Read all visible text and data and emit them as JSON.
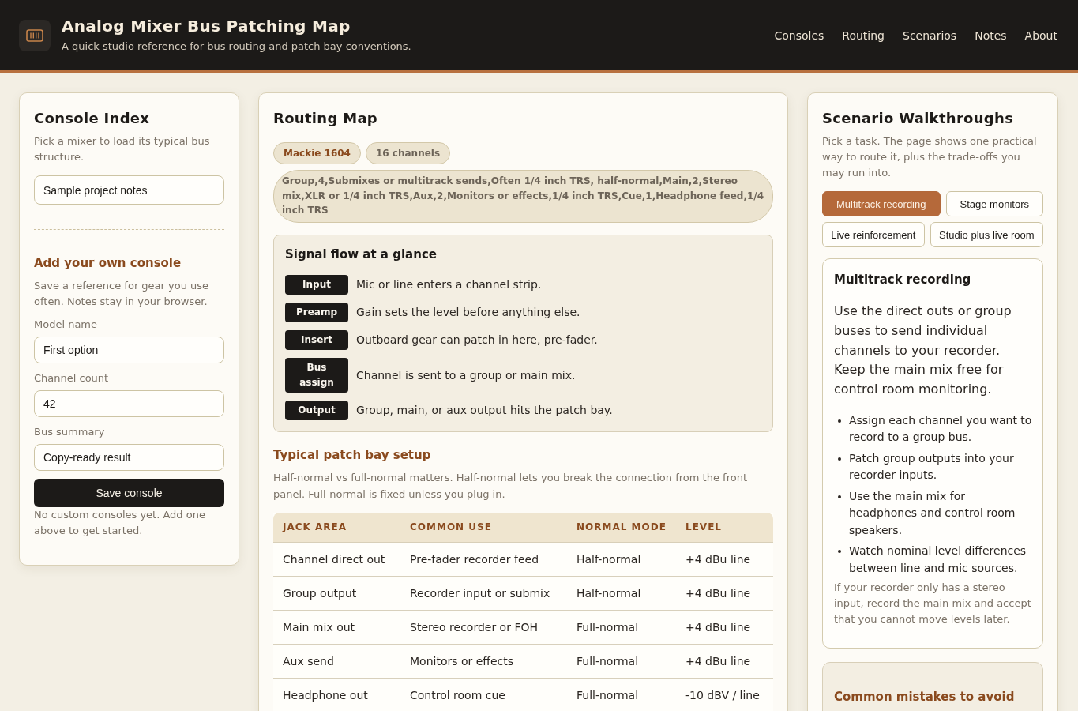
{
  "header": {
    "title": "Analog Mixer Bus Patching Map",
    "subtitle": "A quick studio reference for bus routing and patch bay conventions.",
    "nav": [
      "Consoles",
      "Routing",
      "Scenarios",
      "Notes",
      "About"
    ]
  },
  "console_index": {
    "title": "Console Index",
    "description": "Pick a mixer to load its typical bus structure.",
    "notes_field": {
      "value": "Sample project notes"
    },
    "add_console": {
      "title": "Add your own console",
      "description": "Save a reference for gear you use often. Notes stay in your browser.",
      "fields": [
        {
          "label": "Model name",
          "value": "First option"
        },
        {
          "label": "Channel count",
          "value": "42"
        },
        {
          "label": "Bus summary",
          "value": "Copy-ready result"
        }
      ],
      "save_button": "Save console",
      "empty_note": "No custom consoles yet. Add one above to get started."
    }
  },
  "routing_map": {
    "title": "Routing Map",
    "chips": [
      {
        "kind": "model",
        "label": "Mackie 1604"
      },
      {
        "kind": "count",
        "label": "16 channels"
      }
    ],
    "bus_summary": "Group,4,Submixes or multitrack sends,Often 1/4 inch TRS, half-normal,Main,2,Stereo mix,XLR or 1/4 inch TRS,Aux,2,Monitors or effects,1/4 inch TRS,Cue,1,Headphone feed,1/4 inch TRS",
    "signal_flow": {
      "title": "Signal flow at a glance",
      "steps": [
        {
          "label": "Input",
          "description": "Mic or line enters a channel strip."
        },
        {
          "label": "Preamp",
          "description": "Gain sets the level before anything else."
        },
        {
          "label": "Insert",
          "description": "Outboard gear can patch in here, pre-fader."
        },
        {
          "label": "Bus assign",
          "description": "Channel is sent to a group or main mix."
        },
        {
          "label": "Output",
          "description": "Group, main, or aux output hits the patch bay."
        }
      ]
    },
    "patch_bay": {
      "title": "Typical patch bay setup",
      "description": "Half-normal vs full-normal matters. Half-normal lets you break the connection from the front panel. Full-normal is fixed unless you plug in.",
      "table": {
        "columns": [
          "JACK AREA",
          "COMMON USE",
          "NORMAL MODE",
          "LEVEL"
        ],
        "rows": [
          [
            "Channel direct out",
            "Pre-fader recorder feed",
            "Half-normal",
            "+4 dBu line"
          ],
          [
            "Group output",
            "Recorder input or submix",
            "Half-normal",
            "+4 dBu line"
          ],
          [
            "Main mix out",
            "Stereo recorder or FOH",
            "Full-normal",
            "+4 dBu line"
          ],
          [
            "Aux send",
            "Monitors or effects",
            "Full-normal",
            "+4 dBu line"
          ],
          [
            "Headphone out",
            "Control room cue",
            "Full-normal",
            "-10 dBV / line"
          ]
        ]
      }
    }
  },
  "scenarios": {
    "title": "Scenario Walkthroughs",
    "description": "Pick a task. The page shows one practical way to route it, plus the trade-offs you may run into.",
    "tabs": [
      {
        "label": "Multitrack recording",
        "selected": true
      },
      {
        "label": "Stage monitors",
        "selected": false
      },
      {
        "label": "Live reinforcement",
        "selected": false
      },
      {
        "label": "Studio plus live room",
        "selected": false
      }
    ],
    "detail": {
      "title": "Multitrack recording",
      "summary": "Use the direct outs or group buses to send individual channels to your recorder. Keep the main mix free for control room monitoring.",
      "steps": [
        "Assign each channel you want to record to a group bus.",
        "Patch group outputs into your recorder inputs.",
        "Use the main mix for headphones and control room speakers.",
        "Watch nominal level differences between line and mic sources."
      ],
      "note": "If your recorder only has a stereo input, record the main mix and accept that you cannot move levels later."
    },
    "mistakes": {
      "title": "Common mistakes to avoid"
    }
  }
}
